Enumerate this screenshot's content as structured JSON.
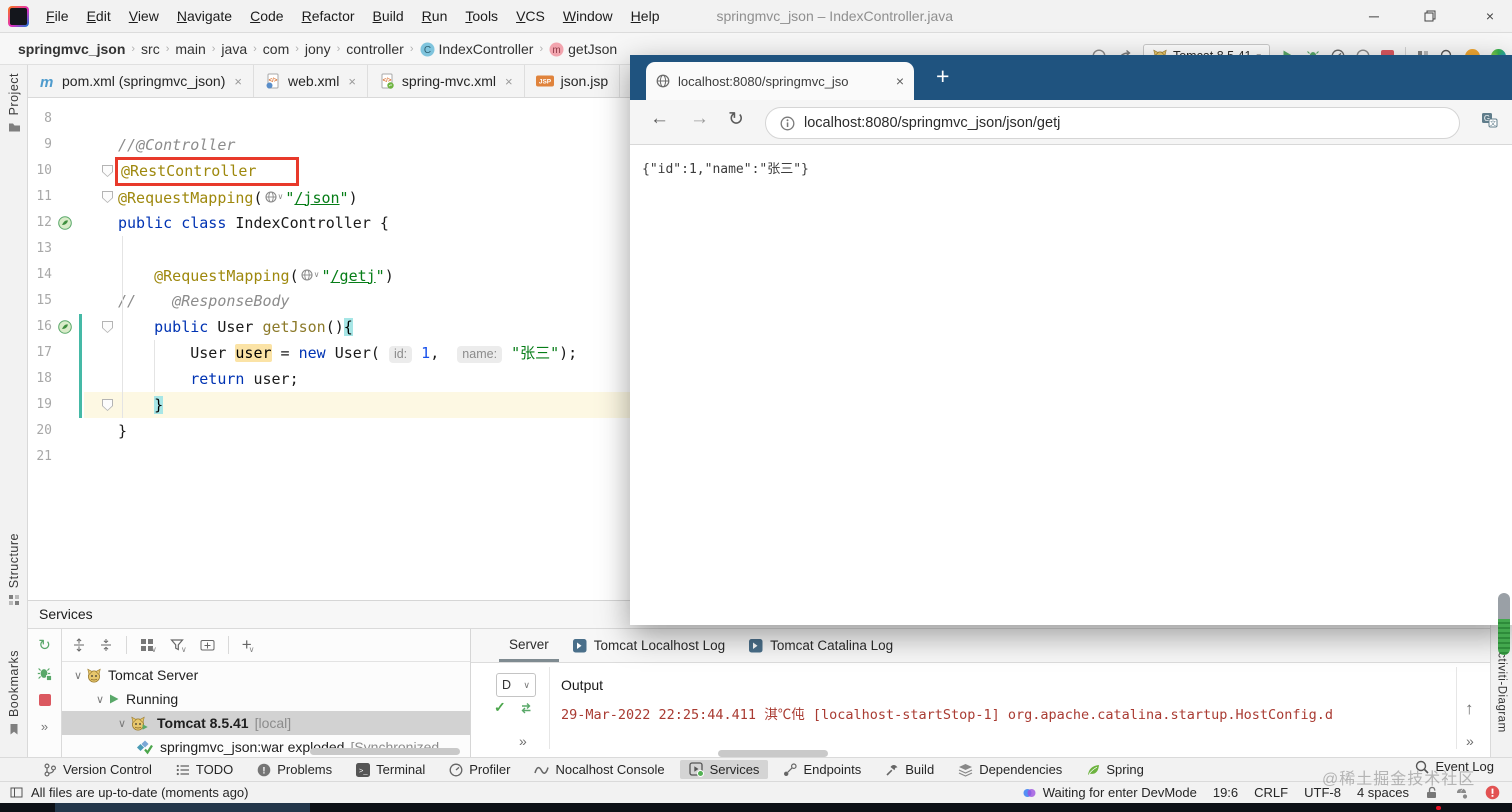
{
  "window": {
    "title": "springmvc_json – IndexController.java",
    "menus": [
      "File",
      "Edit",
      "View",
      "Navigate",
      "Code",
      "Refactor",
      "Build",
      "Run",
      "Tools",
      "VCS",
      "Window",
      "Help"
    ],
    "controls": {
      "minimize": "─",
      "close": "×"
    }
  },
  "toolbar": {
    "run_config": "Tomcat 8.5.41"
  },
  "breadcrumbs": {
    "items": [
      "springmvc_json",
      "src",
      "main",
      "java",
      "com",
      "jony",
      "controller",
      "IndexController",
      "getJson"
    ]
  },
  "left_stripe": {
    "items": [
      "Project",
      "Structure",
      "Bookmarks"
    ]
  },
  "right_stripe": {
    "label": "N-Activiti-Diagram"
  },
  "editor_tabs": [
    {
      "label": "pom.xml (springmvc_json)",
      "icon": "maven"
    },
    {
      "label": "web.xml",
      "icon": "xml-file"
    },
    {
      "label": "spring-mvc.xml",
      "icon": "spring-xml-file"
    },
    {
      "label": "json.jsp",
      "icon": "jsp-file"
    }
  ],
  "editor": {
    "lines": [
      {
        "num": 8,
        "tokens": []
      },
      {
        "num": 9,
        "tokens": [
          {
            "t": "cm",
            "x": "//@Controller"
          }
        ]
      },
      {
        "num": 10,
        "fold": true,
        "tokens": [
          {
            "t": "an box",
            "x": "@RestController"
          }
        ]
      },
      {
        "num": 11,
        "fold": true,
        "tokens": [
          {
            "t": "an",
            "x": "@RequestMapping"
          },
          {
            "t": "pl",
            "x": "("
          },
          {
            "t": "url"
          },
          {
            "t": "st",
            "x": "\""
          },
          {
            "t": "st u",
            "x": "/json"
          },
          {
            "t": "st",
            "x": "\""
          },
          {
            "t": "pl",
            "x": ")"
          }
        ]
      },
      {
        "num": 12,
        "gutter": "spring-bean",
        "tokens": [
          {
            "t": "kw",
            "x": "public"
          },
          {
            "t": "pl",
            "x": " "
          },
          {
            "t": "kw",
            "x": "class"
          },
          {
            "t": "pl",
            "x": " IndexController {"
          }
        ]
      },
      {
        "num": 13,
        "tokens": []
      },
      {
        "num": 14,
        "tokens": [
          {
            "t": "pl",
            "x": "    "
          },
          {
            "t": "an",
            "x": "@RequestMapping"
          },
          {
            "t": "pl",
            "x": "("
          },
          {
            "t": "url"
          },
          {
            "t": "st",
            "x": "\""
          },
          {
            "t": "st u",
            "x": "/getj"
          },
          {
            "t": "st",
            "x": "\""
          },
          {
            "t": "pl",
            "x": ")"
          }
        ]
      },
      {
        "num": 15,
        "tokens": [
          {
            "t": "cm",
            "x": "//    @ResponseBody"
          }
        ]
      },
      {
        "num": 16,
        "gutter": "spring-bean",
        "fold": true,
        "tokens": [
          {
            "t": "pl",
            "x": "    "
          },
          {
            "t": "kw",
            "x": "public"
          },
          {
            "t": "pl",
            "x": " User "
          },
          {
            "t": "mt",
            "x": "getJson"
          },
          {
            "t": "pl",
            "x": "()"
          },
          {
            "t": "bh",
            "x": "{"
          }
        ]
      },
      {
        "num": 17,
        "tokens": [
          {
            "t": "pl",
            "x": "        User "
          },
          {
            "t": "wr",
            "x": "user"
          },
          {
            "t": "pl",
            "x": " = "
          },
          {
            "t": "kw",
            "x": "new"
          },
          {
            "t": "pl",
            "x": " User( "
          },
          {
            "t": "inlay",
            "x": "id:"
          },
          {
            "t": "pl",
            "x": " "
          },
          {
            "t": "num",
            "x": "1"
          },
          {
            "t": "pl",
            "x": ",  "
          },
          {
            "t": "inlay",
            "x": "name:"
          },
          {
            "t": "pl",
            "x": " "
          },
          {
            "t": "st",
            "x": "\"张三\""
          },
          {
            "t": "pl",
            "x": ");"
          }
        ]
      },
      {
        "num": 18,
        "tokens": [
          {
            "t": "pl",
            "x": "        "
          },
          {
            "t": "kw",
            "x": "return"
          },
          {
            "t": "pl",
            "x": " user;"
          }
        ]
      },
      {
        "num": 19,
        "fold": true,
        "current": true,
        "tokens": [
          {
            "t": "pl",
            "x": "    "
          },
          {
            "t": "bh",
            "x": "}"
          }
        ]
      },
      {
        "num": 20,
        "tokens": [
          {
            "t": "pl",
            "x": "}"
          }
        ]
      },
      {
        "num": 21,
        "tokens": []
      }
    ]
  },
  "browser": {
    "tab_title": "localhost:8080/springmvc_jso",
    "url": "localhost:8080/springmvc_json/json/getj",
    "body": "{\"id\":1,\"name\":\"张三\"}"
  },
  "services": {
    "title": "Services",
    "tree": [
      {
        "label": "Tomcat Server",
        "icon": "tomcat",
        "level": 0
      },
      {
        "label": "Running",
        "icon": "run-tri",
        "level": 1
      },
      {
        "label": "Tomcat 8.5.41",
        "suffix": "[local]",
        "icon": "tomcat",
        "level": 2,
        "selected": true,
        "bold": true
      },
      {
        "label": "springmvc_json:war exploded",
        "suffix": "[Synchronized",
        "icon": "artifact",
        "level": 3,
        "nochev": true
      }
    ]
  },
  "server_pane": {
    "tabs": [
      "Server",
      "Tomcat Localhost Log",
      "Tomcat Catalina Log"
    ],
    "selected_tab": "Server",
    "dropdown": "D",
    "output_label": "Output",
    "log_line": "29-Mar-2022 22:25:44.411 淇℃伅 [localhost-startStop-1] org.apache.catalina.startup.HostConfig.d"
  },
  "bottom_bar": {
    "left": [
      "Version Control",
      "TODO",
      "Problems",
      "Terminal",
      "Profiler",
      "Nocalhost Console",
      "Services",
      "Endpoints",
      "Build",
      "Dependencies",
      "Spring"
    ],
    "selected": "Services",
    "right": "Event Log"
  },
  "status_bar": {
    "message": "All files are up-to-date (moments ago)",
    "devmode": "Waiting for enter DevMode",
    "caret": "19:6",
    "line_ending": "CRLF",
    "encoding": "UTF-8",
    "indent": "4 spaces"
  },
  "watermark": "@稀土掘金技术社区",
  "colors": {
    "browser_blue": "#1f537f",
    "annotation": "#9e880d",
    "keyword": "#0033b3",
    "string": "#067d17",
    "number": "#1750eb",
    "comment": "#8c8c8c",
    "error_red": "#e8392a",
    "run_green": "#59a869",
    "stop_red": "#db5860",
    "log_red": "#a93b32"
  }
}
